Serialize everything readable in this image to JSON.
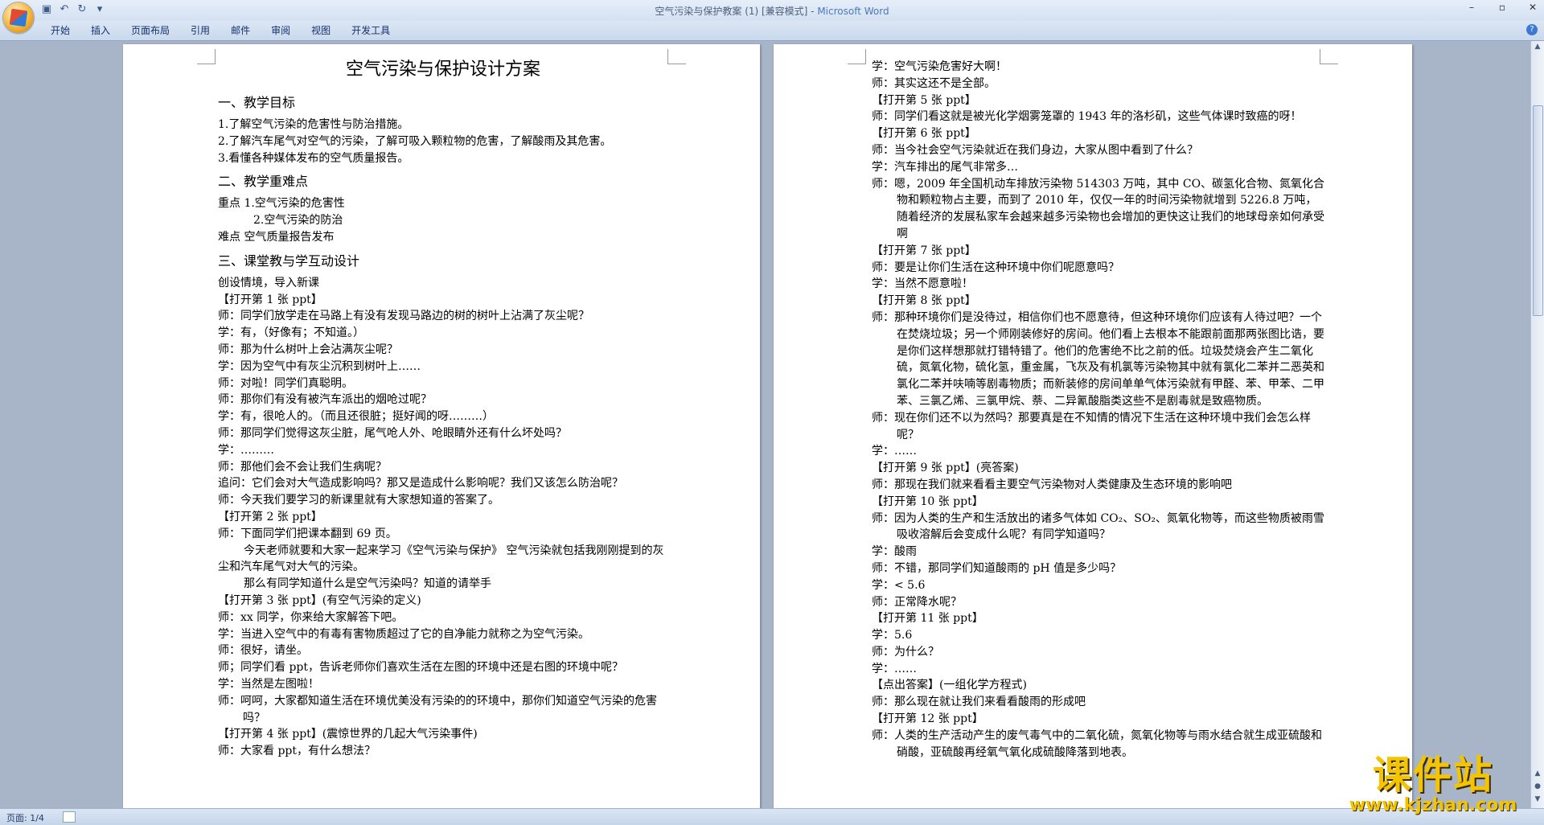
{
  "window": {
    "doc_title": "空气污染与保护教案 (1) [兼容模式] - ",
    "app_name": "Microsoft Word"
  },
  "ribbon": {
    "tabs": [
      "开始",
      "插入",
      "页面布局",
      "引用",
      "邮件",
      "审阅",
      "视图",
      "开发工具"
    ]
  },
  "status": {
    "page_info": "页面: 1/4"
  },
  "watermark": {
    "title": "课件站",
    "url": "www.kjzhan.com"
  },
  "page1": {
    "heading": "空气污染与保护设计方案",
    "section1_title": "一、教学目标",
    "objectives": [
      "1.了解空气污染的危害性与防治措施。",
      "2.了解汽车尾气对空气的污染，了解可吸入颗粒物的危害，了解酸雨及其危害。",
      "3.看懂各种媒体发布的空气质量报告。"
    ],
    "section2_title": "二、教学重难点",
    "key_points": [
      "重点  1.空气污染的危害性",
      "2.空气污染的防治",
      "难点    空气质量报告发布"
    ],
    "section3_title": "三、课堂教与学互动设计",
    "lines": [
      "创设情境，导入新课",
      "【打开第 1 张 ppt】",
      "师：同学们放学走在马路上有没有发现马路边的树的树叶上沾满了灰尘呢？",
      "学：有，（好像有；不知道。）",
      "师：那为什么树叶上会沾满灰尘呢？",
      "学：因为空气中有灰尘沉积到树叶上……",
      "师：对啦！同学们真聪明。",
      "师：那你们有没有被汽车派出的烟呛过呢？",
      "学：有，很呛人的。（而且还很脏；挺好闻的呀………）",
      "师：那同学们觉得这灰尘脏，尾气呛人外、呛眼睛外还有什么坏处吗？",
      "学：………",
      "师：那他们会不会让我们生病呢？",
      "追问：它们会对大气造成影响吗？那又是造成什么影响呢？我们又该怎么防治呢？",
      "师：今天我们要学习的新课里就有大家想知道的答案了。",
      "【打开第 2 张 ppt】",
      "师：下面同学们把课本翻到 69 页。",
      "今天老师就要和大家一起来学习《空气污染与保护》 空气污染就包括我刚刚提到的灰尘和汽车尾气对大气的污染。",
      "那么有同学知道什么是空气污染吗？知道的请举手",
      "【打开第 3 张 ppt】(有空气污染的定义)",
      "师：xx 同学，你来给大家解答下吧。",
      "学：当进入空气中的有毒有害物质超过了它的自净能力就称之为空气污染。",
      "师：很好，请坐。",
      "师；同学们看 ppt，告诉老师你们喜欢生活在左图的环境中还是右图的环境中呢？",
      "学：当然是左图啦！",
      "师：呵呵，大家都知道生活在环境优美没有污染的的环境中，那你们知道空气污染的危害吗？",
      "【打开第 4 张 ppt】(震惊世界的几起大气污染事件)",
      "师：大家看 ppt，有什么想法？"
    ]
  },
  "page2": {
    "lines": [
      "学：空气污染危害好大啊！",
      "师：其实这还不是全部。",
      "【打开第 5 张 ppt】",
      "师：同学们看这就是被光化学烟雾笼罩的 1943 年的洛杉矶，这些气体课时致癌的呀！",
      "【打开第 6 张 ppt】",
      "师：当今社会空气污染就近在我们身边，大家从图中看到了什么？",
      "学：汽车排出的尾气非常多…",
      "师：嗯，2009 年全国机动车排放污染物 514303 万吨，其中 CO、碳氢化合物、氮氧化合物和颗粒物占主要，而到了 2010 年，仅仅一年的时间污染物就增到 5226.8 万吨，随着经济的发展私家车会越来越多污染物也会增加的更快这让我们的地球母亲如何承受啊",
      "【打开第 7 张 ppt】",
      "师：要是让你们生活在这种环境中你们呢愿意吗？",
      "学：当然不愿意啦！",
      "【打开第 8 张 ppt】",
      "师：那种环境你们是没待过，相信你们也不愿意待，但这种环境你们应该有人待过吧？一个在焚烧垃圾；另一个师刚装修好的房间。他们看上去根本不能跟前面那两张图比诰，要是你们这样想那就打错特错了。他们的危害绝不比之前的低。垃圾焚烧会产生二氧化硫，氮氧化物，硫化氢，重金属，飞灰及有机氯等污染物其中就有氯化二苯并二恶英和氯化二苯并呋喃等剧毒物质；而新装修的房间单单气体污染就有甲醛、苯、甲苯、二甲苯、三氯乙烯、三氯甲烷、萘、二异氰酸脂类这些不是剧毒就是致癌物质。",
      "师：现在你们还不以为然吗？那要真是在不知情的情况下生活在这种环境中我们会怎么样呢？",
      "学：……",
      "【打开第 9 张 ppt】(亮答案)",
      "师：那现在我们就来看看主要空气污染物对人类健康及生态环境的影响吧",
      "【打开第 10 张 ppt】",
      "师：因为人类的生产和生活放出的诸多气体如 CO₂、SO₂、氮氧化物等，而这些物质被雨雪吸收溶解后会变成什么呢？有同学知道吗？",
      "学：酸雨",
      "师：不错，那同学们知道酸雨的 pH 值是多少吗？",
      "学：< 5.6",
      "师：正常降水呢？",
      "【打开第 11 张 ppt】",
      "学：5.6",
      "师：为什么？",
      "学：……",
      "【点出答案】(一组化学方程式)",
      "师：那么现在就让我们来看看酸雨的形成吧",
      "【打开第 12 张 ppt】",
      "师：人类的生产活动产生的废气毒气中的二氧化硫，氮氧化物等与雨水结合就生成亚硫酸和硝酸，亚硫酸再经氧气氧化成硫酸降落到地表。"
    ]
  }
}
